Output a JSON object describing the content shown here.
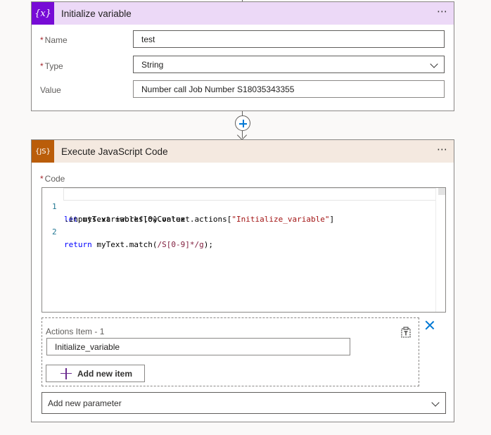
{
  "init_card": {
    "title": "Initialize variable",
    "icon": "{x}",
    "icon_name": "variable-icon",
    "accent": "#770bd6",
    "header_bg": "#ecd9f7",
    "more": "⋯",
    "fields": {
      "name": {
        "label": "Name",
        "required": "*",
        "value": "test"
      },
      "type": {
        "label": "Type",
        "required": "*",
        "value": "String"
      },
      "value": {
        "label": "Value",
        "value": "Number call Job Number S18035343355"
      }
    }
  },
  "js_card": {
    "title": "Execute JavaScript Code",
    "icon": "{JS}",
    "icon_name": "javascript-icon",
    "accent": "#ba5d0a",
    "header_bg": "#f4e9e0",
    "more": "⋯",
    "code_label": "Code",
    "code_required": "*",
    "code": {
      "line1_num": "1",
      "line1_kw": "let",
      "line1_mid": " myText =workflowContext.actions[",
      "line1_str": "\"Initialize_variable\"",
      "line1_end": "]",
      "line1_wrap": ".inputs.variables[0].value",
      "line2_num": "2",
      "line2_kw": "return",
      "line2_mid": " myText.match(",
      "line2_rx": "/S[0-9]*/g",
      "line2_end": ");"
    },
    "actions_item": {
      "label": "Actions Item - 1",
      "value": "Initialize_variable",
      "add_button": "Add new item"
    },
    "add_parameter": "Add new parameter"
  }
}
